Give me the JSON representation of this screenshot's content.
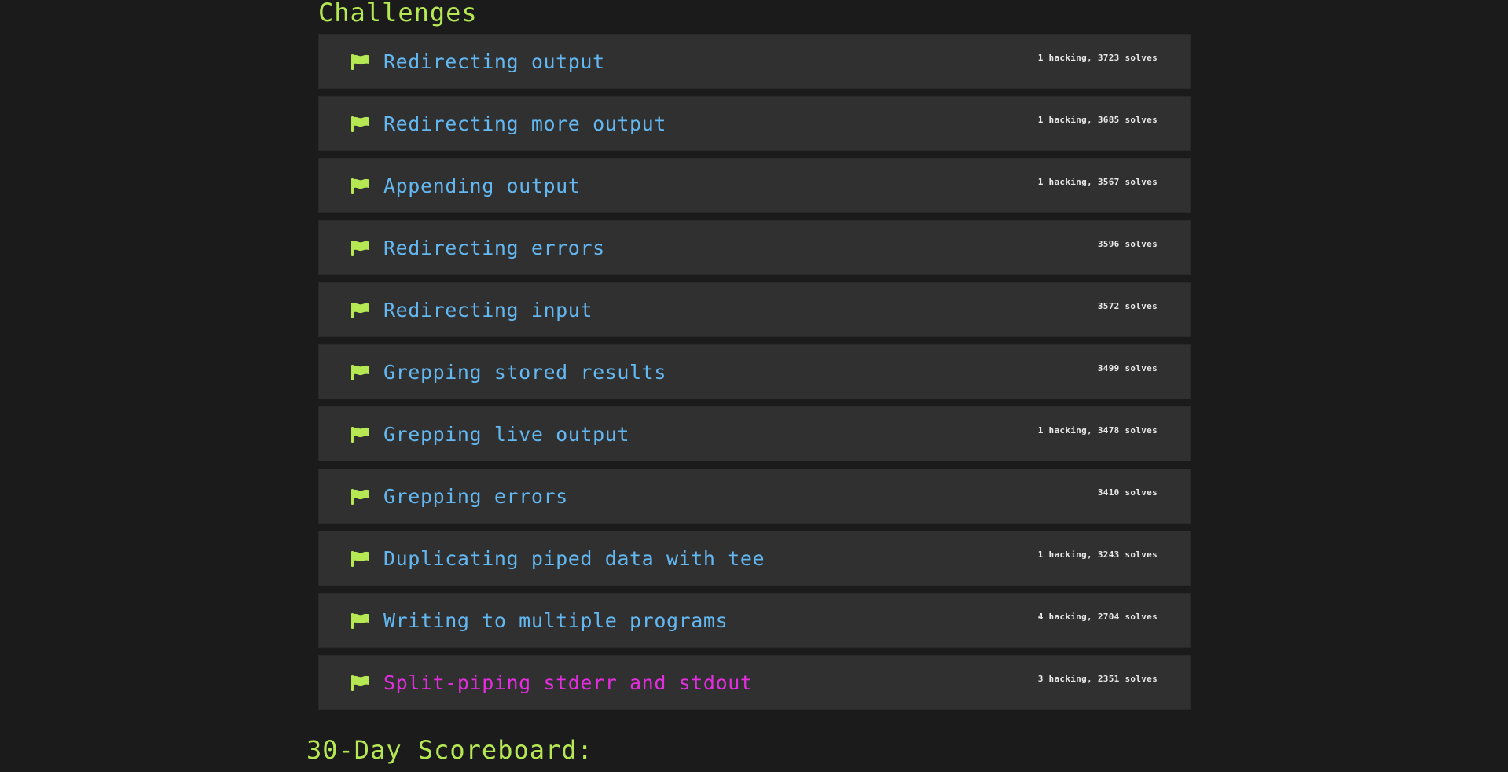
{
  "section_title": "Challenges",
  "scoreboard_title": "30-Day Scoreboard:",
  "colors": {
    "accent_green": "#b5e853",
    "challenge_link": "#63b8f2",
    "challenge_active": "#e52de0",
    "row_background": "#303031",
    "page_background": "#1b1b1c"
  },
  "challenges": [
    {
      "name": "Redirecting output",
      "stats": "1 hacking, 3723 solves",
      "icon": "flag-icon",
      "active": false
    },
    {
      "name": "Redirecting more output",
      "stats": "1 hacking, 3685 solves",
      "icon": "flag-icon",
      "active": false
    },
    {
      "name": "Appending output",
      "stats": "1 hacking, 3567 solves",
      "icon": "flag-icon",
      "active": false
    },
    {
      "name": "Redirecting errors",
      "stats": "3596 solves",
      "icon": "flag-icon",
      "active": false
    },
    {
      "name": "Redirecting input",
      "stats": "3572 solves",
      "icon": "flag-icon",
      "active": false
    },
    {
      "name": "Grepping stored results",
      "stats": "3499 solves",
      "icon": "flag-icon",
      "active": false
    },
    {
      "name": "Grepping live output",
      "stats": "1 hacking, 3478 solves",
      "icon": "flag-icon",
      "active": false
    },
    {
      "name": "Grepping errors",
      "stats": "3410 solves",
      "icon": "flag-icon",
      "active": false
    },
    {
      "name": "Duplicating piped data with tee",
      "stats": "1 hacking, 3243 solves",
      "icon": "flag-icon",
      "active": false
    },
    {
      "name": "Writing to multiple programs",
      "stats": "4 hacking, 2704 solves",
      "icon": "flag-icon",
      "active": false
    },
    {
      "name": "Split-piping stderr and stdout",
      "stats": "3 hacking, 2351 solves",
      "icon": "flag-icon",
      "active": true
    }
  ]
}
